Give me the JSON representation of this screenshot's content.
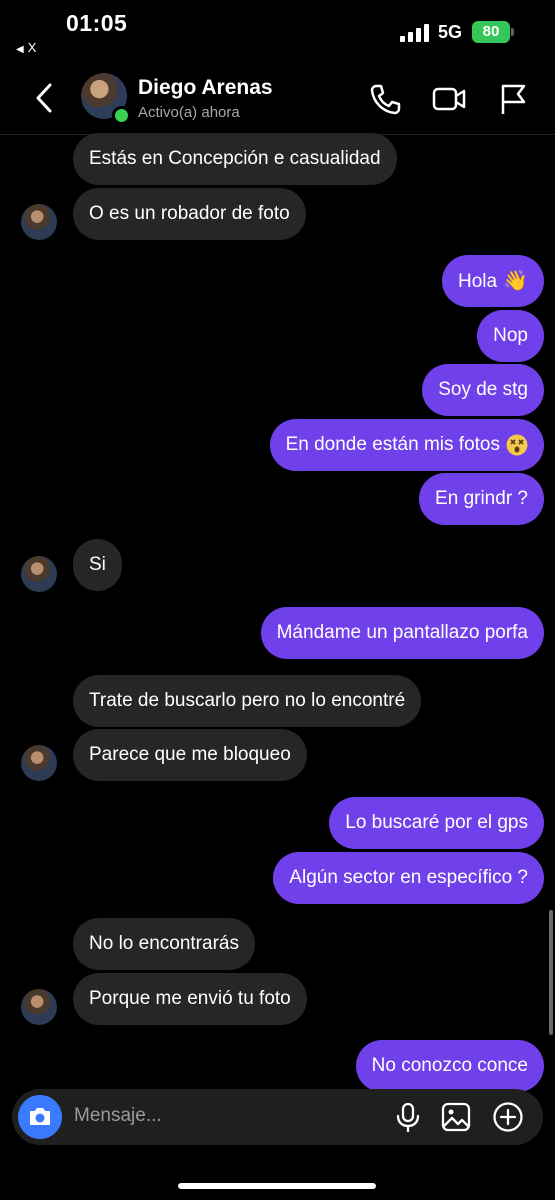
{
  "status_bar": {
    "time": "01:05",
    "back_app_label": "X",
    "network": "5G",
    "battery": "80"
  },
  "header": {
    "contact_name": "Diego Arenas",
    "contact_status": "Activo(a) ahora",
    "icons": [
      "back-icon",
      "phone-icon",
      "video-call-icon",
      "flag-icon"
    ]
  },
  "messages": [
    {
      "direction": "in",
      "text": "Estás en Concepción e casualidad"
    },
    {
      "direction": "in",
      "text": "O es un robador de foto"
    },
    {
      "direction": "out",
      "text": "Hola",
      "emoji": "waving-hand"
    },
    {
      "direction": "out",
      "text": "Nop"
    },
    {
      "direction": "out",
      "text": "Soy de stg"
    },
    {
      "direction": "out",
      "text": "En donde están mis fotos",
      "emoji": "dizzy-face"
    },
    {
      "direction": "out",
      "text": "En grindr ?"
    },
    {
      "direction": "in",
      "text": "Si"
    },
    {
      "direction": "out",
      "text": "Mándame un pantallazo porfa"
    },
    {
      "direction": "in",
      "text": "Trate de buscarlo pero no lo encontré"
    },
    {
      "direction": "in",
      "text": "Parece que me bloqueo"
    },
    {
      "direction": "out",
      "text": "Lo buscaré por el gps"
    },
    {
      "direction": "out",
      "text": "Algún sector en específico ?"
    },
    {
      "direction": "in",
      "text": "No lo encontrarás"
    },
    {
      "direction": "in",
      "text": "Porque me envió tu foto"
    },
    {
      "direction": "out",
      "text": "No conozco conce"
    }
  ],
  "composer": {
    "placeholder": "Mensaje...",
    "icons": [
      "camera-icon",
      "microphone-icon",
      "image-icon",
      "plus-icon"
    ]
  },
  "colors": {
    "background": "#000000",
    "incoming_bubble": "#262626",
    "outgoing_bubble": "#7040ea",
    "online": "#39d353",
    "camera_button": "#3a7bfd",
    "battery": "#34c759"
  }
}
